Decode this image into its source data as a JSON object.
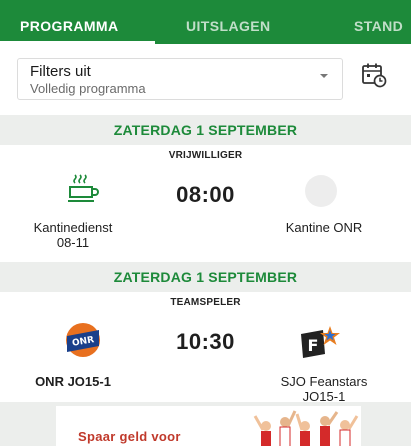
{
  "tabs": [
    {
      "label": "PROGRAMMA",
      "active": true
    },
    {
      "label": "UITSLAGEN",
      "active": false
    },
    {
      "label": "STAND",
      "active": false
    }
  ],
  "filter": {
    "title": "Filters uit",
    "subtitle": "Volledig programma"
  },
  "icons": {
    "calendar": "calendar-refresh-icon",
    "dropdown": "chevron-down-icon",
    "coffee": "coffee-cup-icon",
    "placeholder": "empty-logo-circle"
  },
  "colors": {
    "brand": "#1d8a3a",
    "date_bg": "#eceeec",
    "onr_orange": "#e8701f",
    "onr_blue": "#1a3f8a"
  },
  "matches": [
    {
      "date": "ZATERDAG 1 SEPTEMBER",
      "role": "VRIJWILLIGER",
      "time": "08:00",
      "home": {
        "name": "Kantinedienst\n08-11"
      },
      "away": {
        "name": "Kantine ONR"
      }
    },
    {
      "date": "ZATERDAG 1 SEPTEMBER",
      "role": "TEAMSPELER",
      "time": "10:30",
      "home": {
        "name": "ONR JO15-1",
        "logo_text": "ONR"
      },
      "away": {
        "name": "SJO Feanstars\nJO15-1",
        "logo_text": "F"
      }
    }
  ],
  "ad": {
    "text": "Spaar geld voor"
  }
}
